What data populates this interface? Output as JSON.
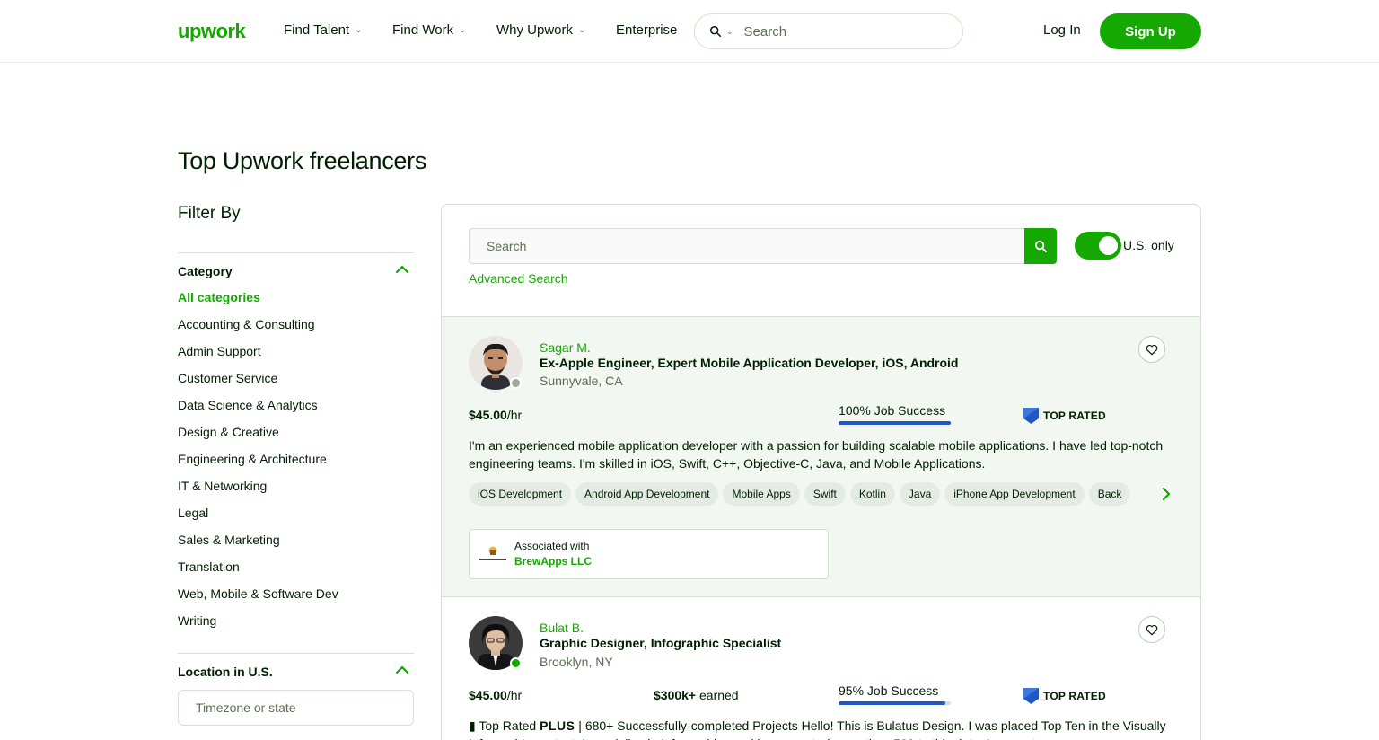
{
  "header": {
    "logo": "upwork",
    "nav": [
      {
        "label": "Find Talent",
        "has_dropdown": true
      },
      {
        "label": "Find Work",
        "has_dropdown": true
      },
      {
        "label": "Why Upwork",
        "has_dropdown": true
      },
      {
        "label": "Enterprise",
        "has_dropdown": false
      }
    ],
    "search_placeholder": "Search",
    "login": "Log In",
    "signup": "Sign Up"
  },
  "page": {
    "title": "Top Upwork freelancers"
  },
  "sidebar": {
    "filter_title": "Filter By",
    "category": {
      "heading": "Category",
      "items": [
        "All categories",
        "Accounting & Consulting",
        "Admin Support",
        "Customer Service",
        "Data Science & Analytics",
        "Design & Creative",
        "Engineering & Architecture",
        "IT & Networking",
        "Legal",
        "Sales & Marketing",
        "Translation",
        "Web, Mobile & Software Dev",
        "Writing"
      ],
      "active": "All categories"
    },
    "location": {
      "heading": "Location in U.S.",
      "placeholder": "Timezone or state"
    }
  },
  "results": {
    "search_placeholder": "Search",
    "us_only_label": "U.S. only",
    "us_only_enabled": true,
    "advanced_search": "Advanced Search",
    "freelancers": [
      {
        "name": "Sagar M.",
        "title": "Ex-Apple Engineer, Expert Mobile Application Developer, iOS, Android",
        "location": "Sunnyvale, CA",
        "online": false,
        "rate_value": "$45.00",
        "rate_unit": "/hr",
        "job_success_text": "100% Job Success",
        "job_success": 1.0,
        "badge": "TOP RATED",
        "bio": "I'm an experienced mobile application developer with a passion for building scalable mobile applications. I have led top-notch engineering teams. I'm skilled in iOS, Swift, C++, Objective-C, Java, and Mobile Applications.",
        "skills": [
          "iOS Development",
          "Android App Development",
          "Mobile Apps",
          "Swift",
          "Kotlin",
          "Java",
          "iPhone App Development",
          "Back"
        ],
        "associated_label": "Associated with",
        "associated_with": "BrewApps LLC",
        "highlighted": true
      },
      {
        "name": "Bulat B.",
        "title": "Graphic Designer, Infographic Specialist",
        "location": "Brooklyn, NY",
        "online": true,
        "rate_value": "$45.00",
        "rate_unit": "/hr",
        "earned_value": "$300k+",
        "earned_unit": "earned",
        "job_success_text": "95% Job Success",
        "job_success": 0.95,
        "badge": "TOP RATED",
        "bio_prefix": "▮ Top Rated ",
        "bio_plus": "PLUS",
        "bio": " | 680+ Successfully-completed Projects Hello! This is Bulatus Design. I was placed Top Ten in the Visually Infographic contest. I specialize in Infographics and have created more than 500 to this date. I guarantee you",
        "highlighted": false
      }
    ]
  },
  "colors": {
    "brand": "#14a800",
    "text": "#001e00",
    "muted": "#5e6d55",
    "job_success_bar": "#1f57c3",
    "badge_blue": "#1f57c3",
    "highlight_bg": "#f2f7f2"
  }
}
